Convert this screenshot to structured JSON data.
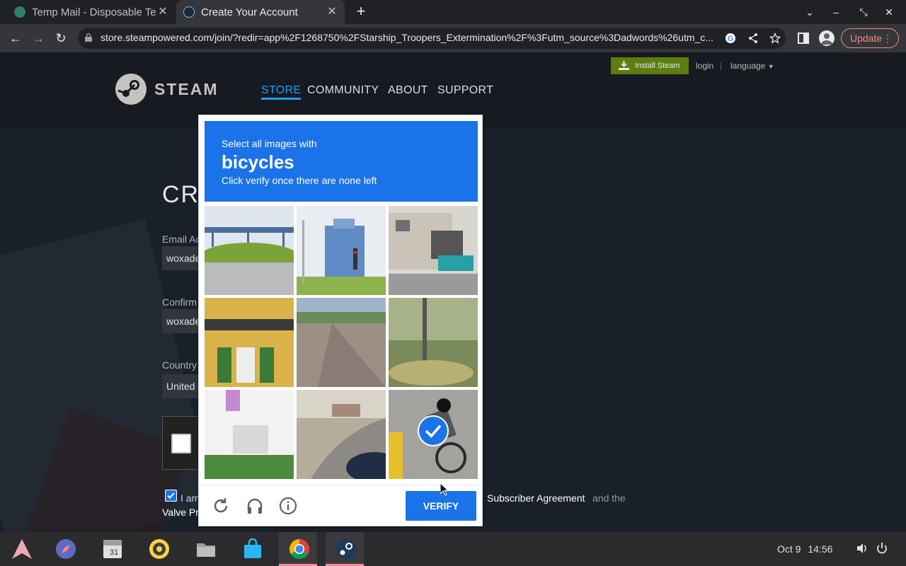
{
  "browser": {
    "tabs": [
      {
        "title": "Temp Mail - Disposable Te",
        "active": false
      },
      {
        "title": "Create Your Account",
        "active": true
      }
    ],
    "url": "store.steampowered.com/join/?redir=app%2F1268750%2FStarship_Troopers_Extermination%2F%3Futm_source%3Dadwords%26utm_c...",
    "update_label": "Update"
  },
  "steam": {
    "logo_text": "STEAM",
    "nav": [
      "STORE",
      "COMMUNITY",
      "ABOUT",
      "SUPPORT"
    ],
    "install_label": "Install Steam",
    "login_label": "login",
    "separator": "|",
    "language_label": "language",
    "form_title": "CRI",
    "email_label": "Email Ac",
    "email_value": "woxade",
    "confirm_label": "Confirm",
    "confirm_value": "woxade",
    "country_label": "Country",
    "country_value": "United",
    "agree_prefix": "I am",
    "agree_link1": "Subscriber Agreement",
    "agree_and": "and the",
    "agree_link2": "Valve Pr"
  },
  "captcha": {
    "line1": "Select all images with",
    "target": "bicycles",
    "line3": "Click verify once there are none left",
    "tiles_selected": [
      false,
      false,
      false,
      false,
      false,
      false,
      false,
      false,
      true
    ],
    "verify_label": "VERIFY"
  },
  "taskbar": {
    "clock_date": "Oct 9",
    "clock_time": "14:56"
  },
  "colors": {
    "captcha_blue": "#1a73e8",
    "steam_active_nav": "#1a9fff",
    "install_green": "#5c7e10"
  }
}
